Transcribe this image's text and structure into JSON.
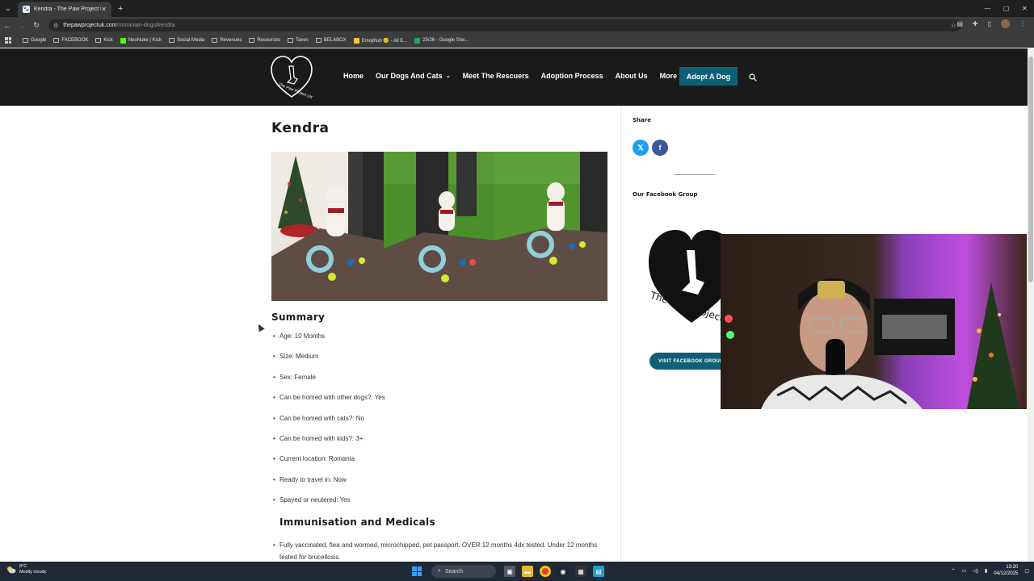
{
  "browser": {
    "tab_title": "Kendra - The Paw Project UK",
    "url_domain": "thepawprojectuk.com",
    "url_path": "/romanian-dogs/kendra",
    "bookmarks": [
      {
        "label": "Google",
        "icon": "folder-icon"
      },
      {
        "label": "FACEBOOK",
        "icon": "folder-icon"
      },
      {
        "label": "Kick",
        "icon": "folder-icon"
      },
      {
        "label": "NeoNuke | Kick",
        "icon": "kick-icon"
      },
      {
        "label": "Social Media",
        "icon": "folder-icon"
      },
      {
        "label": "Revenues",
        "icon": "folder-icon"
      },
      {
        "label": "Resources",
        "icon": "folder-icon"
      },
      {
        "label": "Taxes",
        "icon": "folder-icon"
      },
      {
        "label": "BELABOX",
        "icon": "folder-icon"
      },
      {
        "label": "Emojihub 😊 - All E...",
        "icon": "emoji-icon"
      },
      {
        "label": "25/26 - Google She...",
        "icon": "sheets-icon"
      }
    ]
  },
  "site": {
    "logo_text": "The Paw Project UK",
    "nav": [
      {
        "label": "Home",
        "dropdown": false
      },
      {
        "label": "Our Dogs And Cats",
        "dropdown": true
      },
      {
        "label": "Meet The Rescuers",
        "dropdown": false
      },
      {
        "label": "Adoption Process",
        "dropdown": false
      },
      {
        "label": "About Us",
        "dropdown": false
      },
      {
        "label": "More",
        "dropdown": true
      }
    ],
    "cta_label": "Adopt A Dog",
    "brand_color": "#0d6176"
  },
  "main": {
    "title": "Kendra",
    "summary_heading": "Summary",
    "facts": [
      "Age: 10 Months",
      "Size: Medium",
      "Sex: Female",
      "Can be homed with other dogs?: Yes",
      "Can be homed with cats?: No",
      "Can be homed with kids?: 3+",
      "Current location: Romania",
      "Ready to travel in: Now",
      "Spayed or neutered: Yes"
    ],
    "immunisation_heading": "Immunisation and Medicals",
    "immunisation_text": "Fully vaccinated, flea and wormed, microchipped, pet passport. OVER 12 months 4dx tested. Under 12 months tested for brucellosis."
  },
  "sidebar": {
    "share_heading": "Share",
    "share_x": "𝕏",
    "share_fb": "f",
    "group_heading": "Our Facebook Group",
    "group_logo_text": "The Paw Project",
    "visit_label": "VISIT FACEBOOK GROUP"
  },
  "taskbar": {
    "temp": "8°C",
    "weather": "Mostly cloudy",
    "search_placeholder": "Search",
    "time": "13:20",
    "date": "04/12/2025"
  }
}
